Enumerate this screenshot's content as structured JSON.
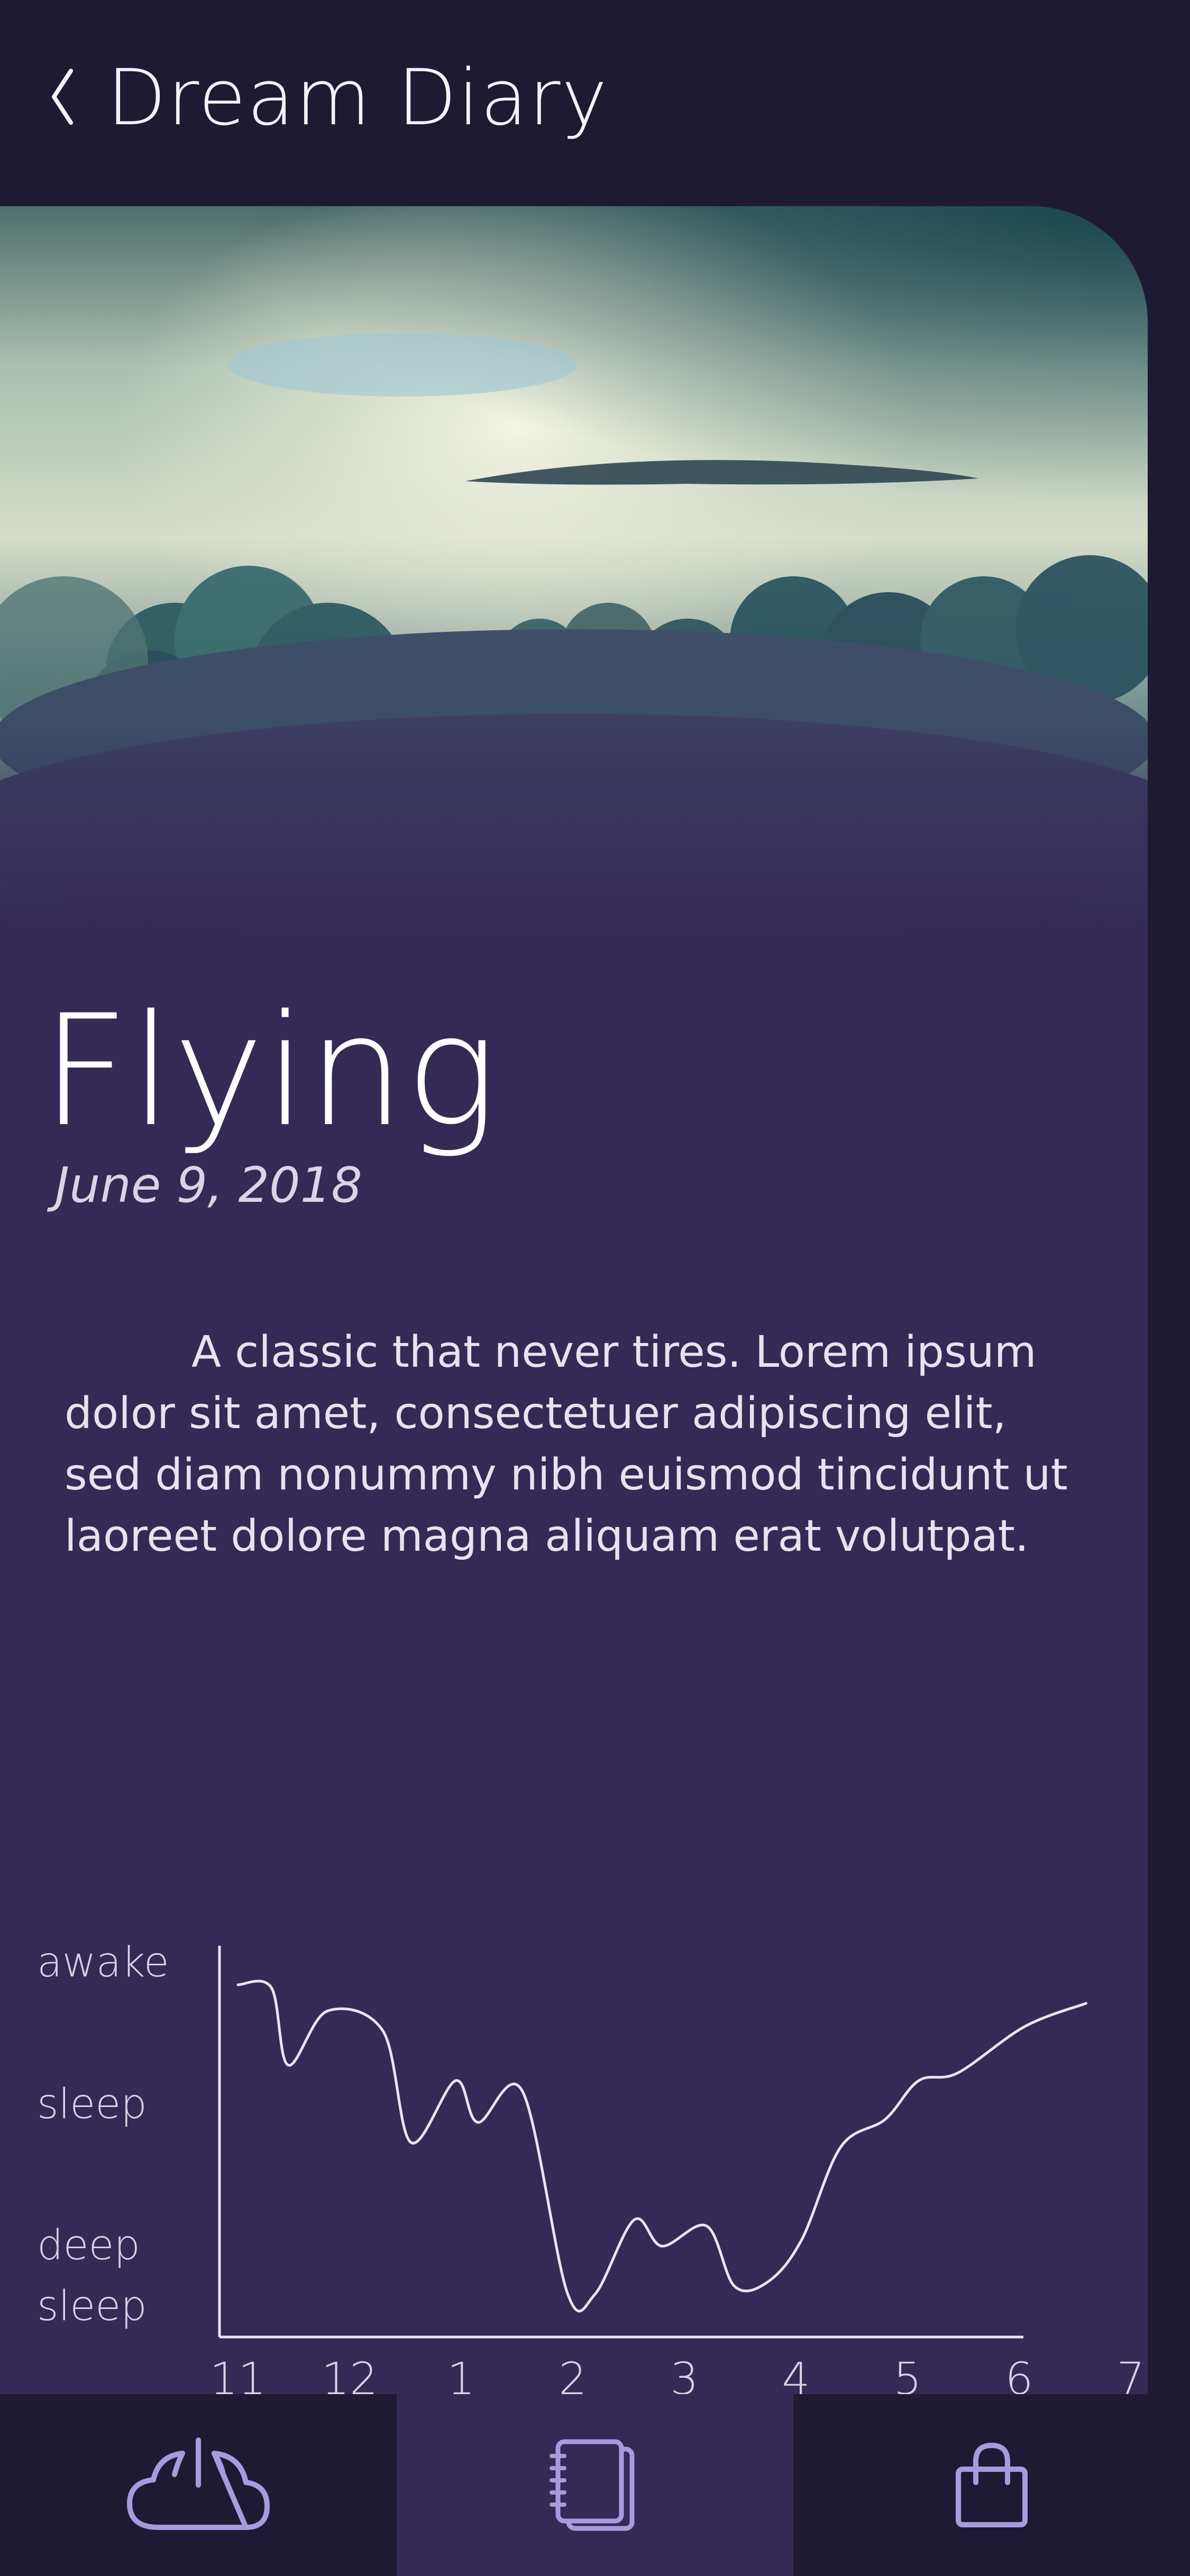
{
  "header": {
    "back_icon": "chevron-left-icon",
    "title": "Dream Diary"
  },
  "entry": {
    "hero_image": "clouds-sky-photo",
    "title": "Flying",
    "date": "June 9, 2018",
    "body": "A classic that never tires. Lorem ipsum dolor sit amet, consectetuer adipiscing elit, sed diam nonummy nibh euismod tincidunt ut laoreet dolore magna aliquam erat volutpat."
  },
  "chart_data": {
    "type": "line",
    "title": "",
    "xlabel": "",
    "ylabel": "",
    "grid": false,
    "y_levels": [
      "awake",
      "sleep",
      "deep sleep"
    ],
    "y_label_lines": [
      [
        "awake"
      ],
      [
        "sleep"
      ],
      [
        "deep",
        "sleep"
      ]
    ],
    "ylim": [
      0,
      2
    ],
    "categories": [
      "11",
      "12",
      "1",
      "2",
      "3",
      "4",
      "5",
      "6",
      "7"
    ],
    "series": [
      {
        "color": "#e9e6f2",
        "x": [
          0,
          0.3,
          0.45,
          0.8,
          1.3,
          1.55,
          1.95,
          2.15,
          2.55,
          2.95,
          3.2,
          3.55,
          3.8,
          4.2,
          4.45,
          4.75,
          5.05,
          5.4,
          5.8,
          6.1,
          6.45,
          7.05,
          7.6
        ],
        "y": [
          0.03,
          0.05,
          0.55,
          0.2,
          0.33,
          1.05,
          0.65,
          0.92,
          0.72,
          2.02,
          2.03,
          1.55,
          1.72,
          1.59,
          1.98,
          1.95,
          1.68,
          1.08,
          0.9,
          0.65,
          0.6,
          0.3,
          0.15
        ]
      }
    ]
  },
  "nav": {
    "tabs": [
      {
        "icon": "cloud-power-icon",
        "active": false
      },
      {
        "icon": "notebook-icon",
        "active": true
      },
      {
        "icon": "shopping-bag-icon",
        "active": false
      }
    ]
  },
  "colors": {
    "background": "#1f1a33",
    "card": "#342a55",
    "accent": "#a79bde",
    "text": "#ffffff",
    "line": "#e9e6f2"
  }
}
